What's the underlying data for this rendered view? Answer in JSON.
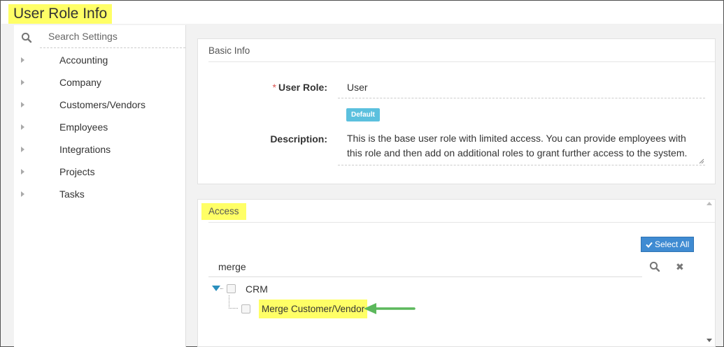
{
  "page": {
    "title": "User Role Info"
  },
  "sidebar": {
    "search_placeholder": "Search Settings",
    "items": [
      {
        "label": "Accounting"
      },
      {
        "label": "Company"
      },
      {
        "label": "Customers/Vendors"
      },
      {
        "label": "Employees"
      },
      {
        "label": "Integrations"
      },
      {
        "label": "Projects"
      },
      {
        "label": "Tasks"
      }
    ]
  },
  "basic_info": {
    "section_title": "Basic Info",
    "required_mark": "*",
    "user_role_label": "User Role:",
    "user_role_value": "User",
    "badge": "Default",
    "description_label": "Description:",
    "description_value": "This is the base user role with limited access.  You can provide employees with this role and then add on additional roles to grant further access to the system."
  },
  "access": {
    "section_title": "Access",
    "select_all_label": "Select All",
    "filter_value": "merge",
    "tree": {
      "root_label": "CRM",
      "root_expanded": true,
      "root_checked": false,
      "child_label": "Merge Customer/Vendor",
      "child_checked": false
    }
  },
  "colors": {
    "highlight": "#ffff66",
    "badge": "#5bc0de",
    "button": "#3f8bd2",
    "arrow": "#5cb85c",
    "required": "#d9534f",
    "tree_toggle": "#2a8fbd"
  },
  "icons": [
    "search-icon",
    "caret-right-icon",
    "check-icon",
    "close-icon",
    "caret-down-icon",
    "arrow-left-icon"
  ]
}
